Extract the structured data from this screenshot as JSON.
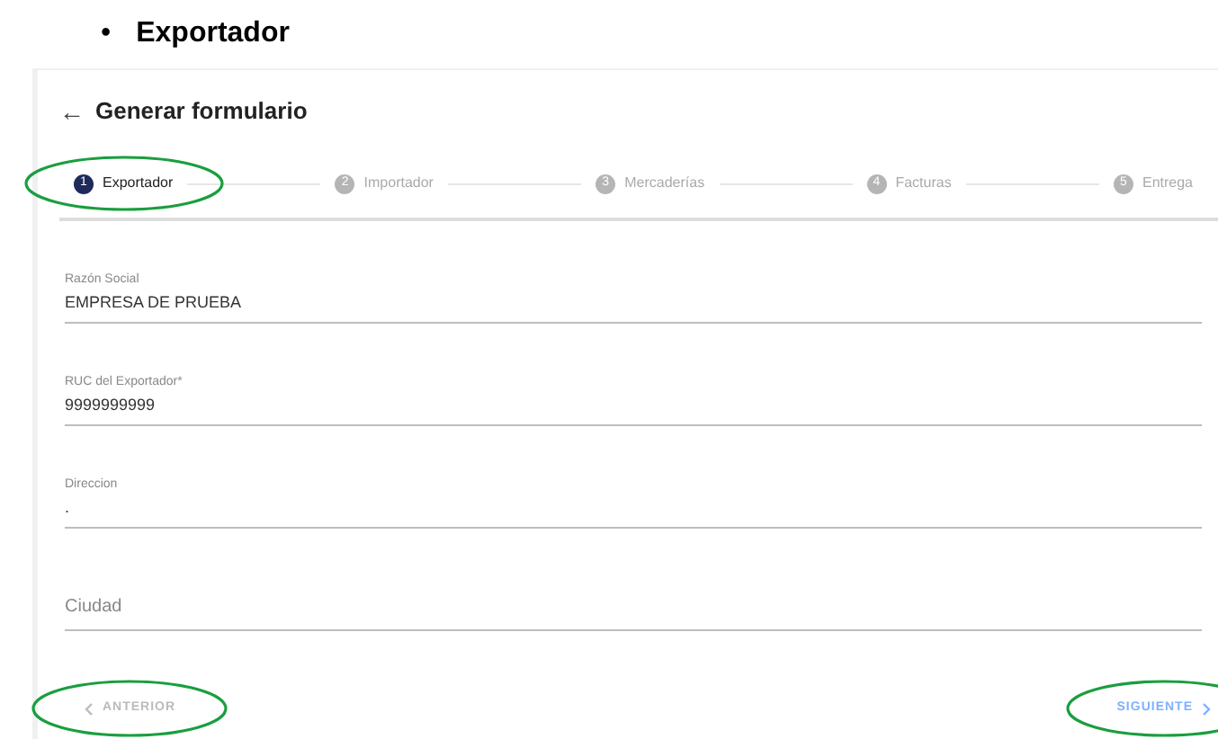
{
  "heading": {
    "bullet": "•",
    "text": "Exportador"
  },
  "form": {
    "back_icon": "←",
    "title": "Generar formulario"
  },
  "steps": [
    {
      "number": "1",
      "label": "Exportador",
      "selected": true,
      "highlighted": true
    },
    {
      "number": "2",
      "label": "Importador",
      "selected": false,
      "highlighted": false
    },
    {
      "number": "3",
      "label": "Mercaderías",
      "selected": false,
      "highlighted": false
    },
    {
      "number": "4",
      "label": "Facturas",
      "selected": false,
      "highlighted": false
    },
    {
      "number": "5",
      "label": "Entrega",
      "selected": false,
      "highlighted": false
    }
  ],
  "fields": [
    {
      "label": "Razón Social",
      "value": "EMPRESA DE PRUEBA"
    },
    {
      "label": "RUC del Exportador*",
      "value": "9999999999"
    },
    {
      "label": "Direccion",
      "value": "."
    },
    {
      "placeholder": "Ciudad"
    }
  ],
  "buttons": [
    {
      "kind": "previous",
      "label": "ANTERIOR",
      "disabled": true,
      "highlighted": true
    },
    {
      "kind": "next",
      "label": "SIGUIENTE",
      "disabled": false,
      "highlighted": true
    }
  ]
}
